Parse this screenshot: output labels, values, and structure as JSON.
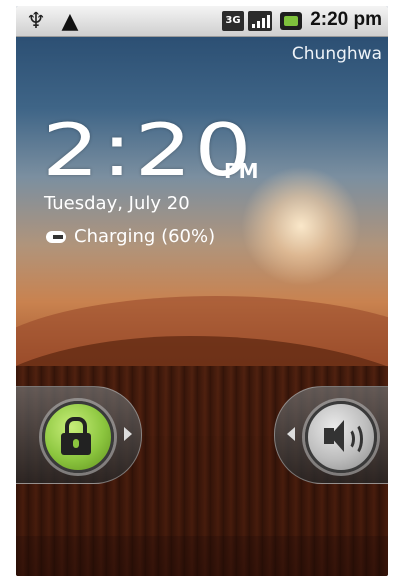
{
  "status_bar": {
    "icons": [
      "usb-icon",
      "warning-icon",
      "network-3g-icon",
      "signal-icon",
      "battery-charging-icon"
    ],
    "network_label": "3G",
    "time": "2:20 pm"
  },
  "carrier": "Chunghwa",
  "lockscreen": {
    "clock_time": "2:20",
    "clock_ampm": "PM",
    "date": "Tuesday, July 20",
    "charging_text": "Charging (60%)"
  },
  "controls": {
    "unlock_icon": "unlock-icon",
    "sound_icon": "sound-icon"
  },
  "colors": {
    "unlock_green": "#8cc63f",
    "statusbar_bg": "#dcdcdc"
  }
}
